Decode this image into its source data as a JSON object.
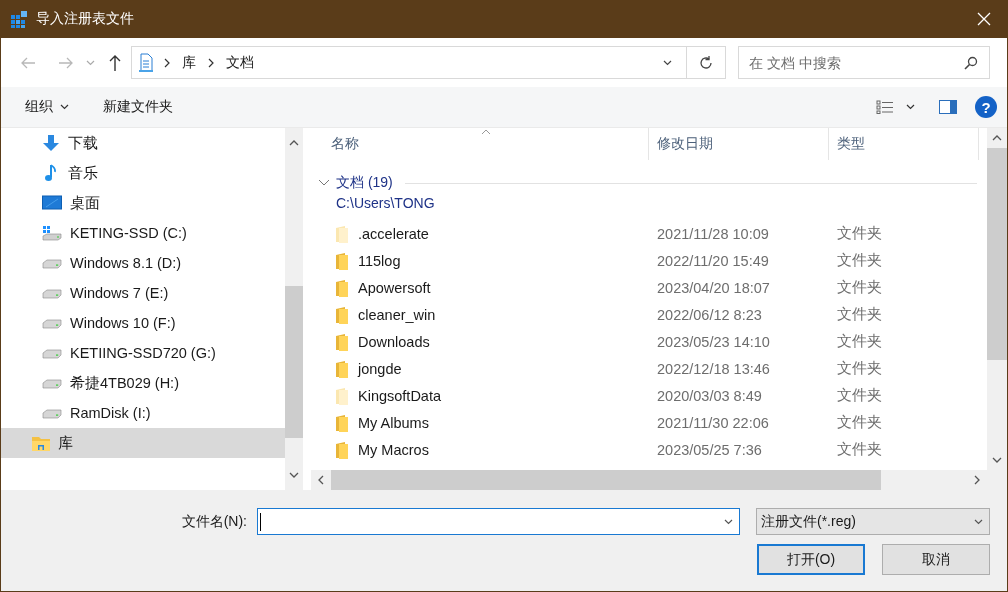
{
  "window": {
    "title": "导入注册表文件"
  },
  "address_bar": {
    "crumbs": [
      "库",
      "文档"
    ]
  },
  "search": {
    "placeholder": "在 文档 中搜索"
  },
  "toolbar": {
    "organize": "组织",
    "new_folder": "新建文件夹",
    "help": "?"
  },
  "sidebar": {
    "items": [
      {
        "kind": "download",
        "label": "下载",
        "selected": false
      },
      {
        "kind": "music",
        "label": "音乐",
        "selected": false
      },
      {
        "kind": "desktop",
        "label": "桌面",
        "selected": false
      },
      {
        "kind": "system-drive",
        "label": "KETING-SSD (C:)",
        "selected": false
      },
      {
        "kind": "drive",
        "label": "Windows 8.1 (D:)",
        "selected": false
      },
      {
        "kind": "drive",
        "label": "Windows 7 (E:)",
        "selected": false
      },
      {
        "kind": "drive",
        "label": "Windows 10 (F:)",
        "selected": false
      },
      {
        "kind": "drive",
        "label": "KETIING-SSD720 (G:)",
        "selected": false
      },
      {
        "kind": "drive",
        "label": "希捷4TB029 (H:)",
        "selected": false
      },
      {
        "kind": "drive",
        "label": "RamDisk (I:)",
        "selected": false
      },
      {
        "kind": "library",
        "label": "库",
        "selected": true
      }
    ]
  },
  "file_list": {
    "columns": [
      "名称",
      "修改日期",
      "类型"
    ],
    "group": {
      "title": "文档 (19)",
      "expanded": true,
      "path": "C:\\Users\\TONG"
    },
    "rows": [
      {
        "name": ".accelerate",
        "modified": "2021/11/28 10:09",
        "type": "文件夹",
        "hidden": true
      },
      {
        "name": "115log",
        "modified": "2022/11/20 15:49",
        "type": "文件夹",
        "hidden": false
      },
      {
        "name": "Apowersoft",
        "modified": "2023/04/20 18:07",
        "type": "文件夹",
        "hidden": false
      },
      {
        "name": "cleaner_win",
        "modified": "2022/06/12 8:23",
        "type": "文件夹",
        "hidden": false
      },
      {
        "name": "Downloads",
        "modified": "2023/05/23 14:10",
        "type": "文件夹",
        "hidden": false
      },
      {
        "name": "jongde",
        "modified": "2022/12/18 13:46",
        "type": "文件夹",
        "hidden": false
      },
      {
        "name": "KingsoftData",
        "modified": "2020/03/03 8:49",
        "type": "文件夹",
        "hidden": true
      },
      {
        "name": "My Albums",
        "modified": "2021/11/30 22:06",
        "type": "文件夹",
        "hidden": false
      },
      {
        "name": "My Macros",
        "modified": "2023/05/25 7:36",
        "type": "文件夹",
        "hidden": false
      }
    ]
  },
  "file_name": {
    "label": "文件名(N):",
    "focused": true
  },
  "file_type": {
    "value": "注册文件(*.reg)"
  },
  "buttons": [
    {
      "label": "打开(O)",
      "default": true
    },
    {
      "label": "取消",
      "default": false
    }
  ]
}
